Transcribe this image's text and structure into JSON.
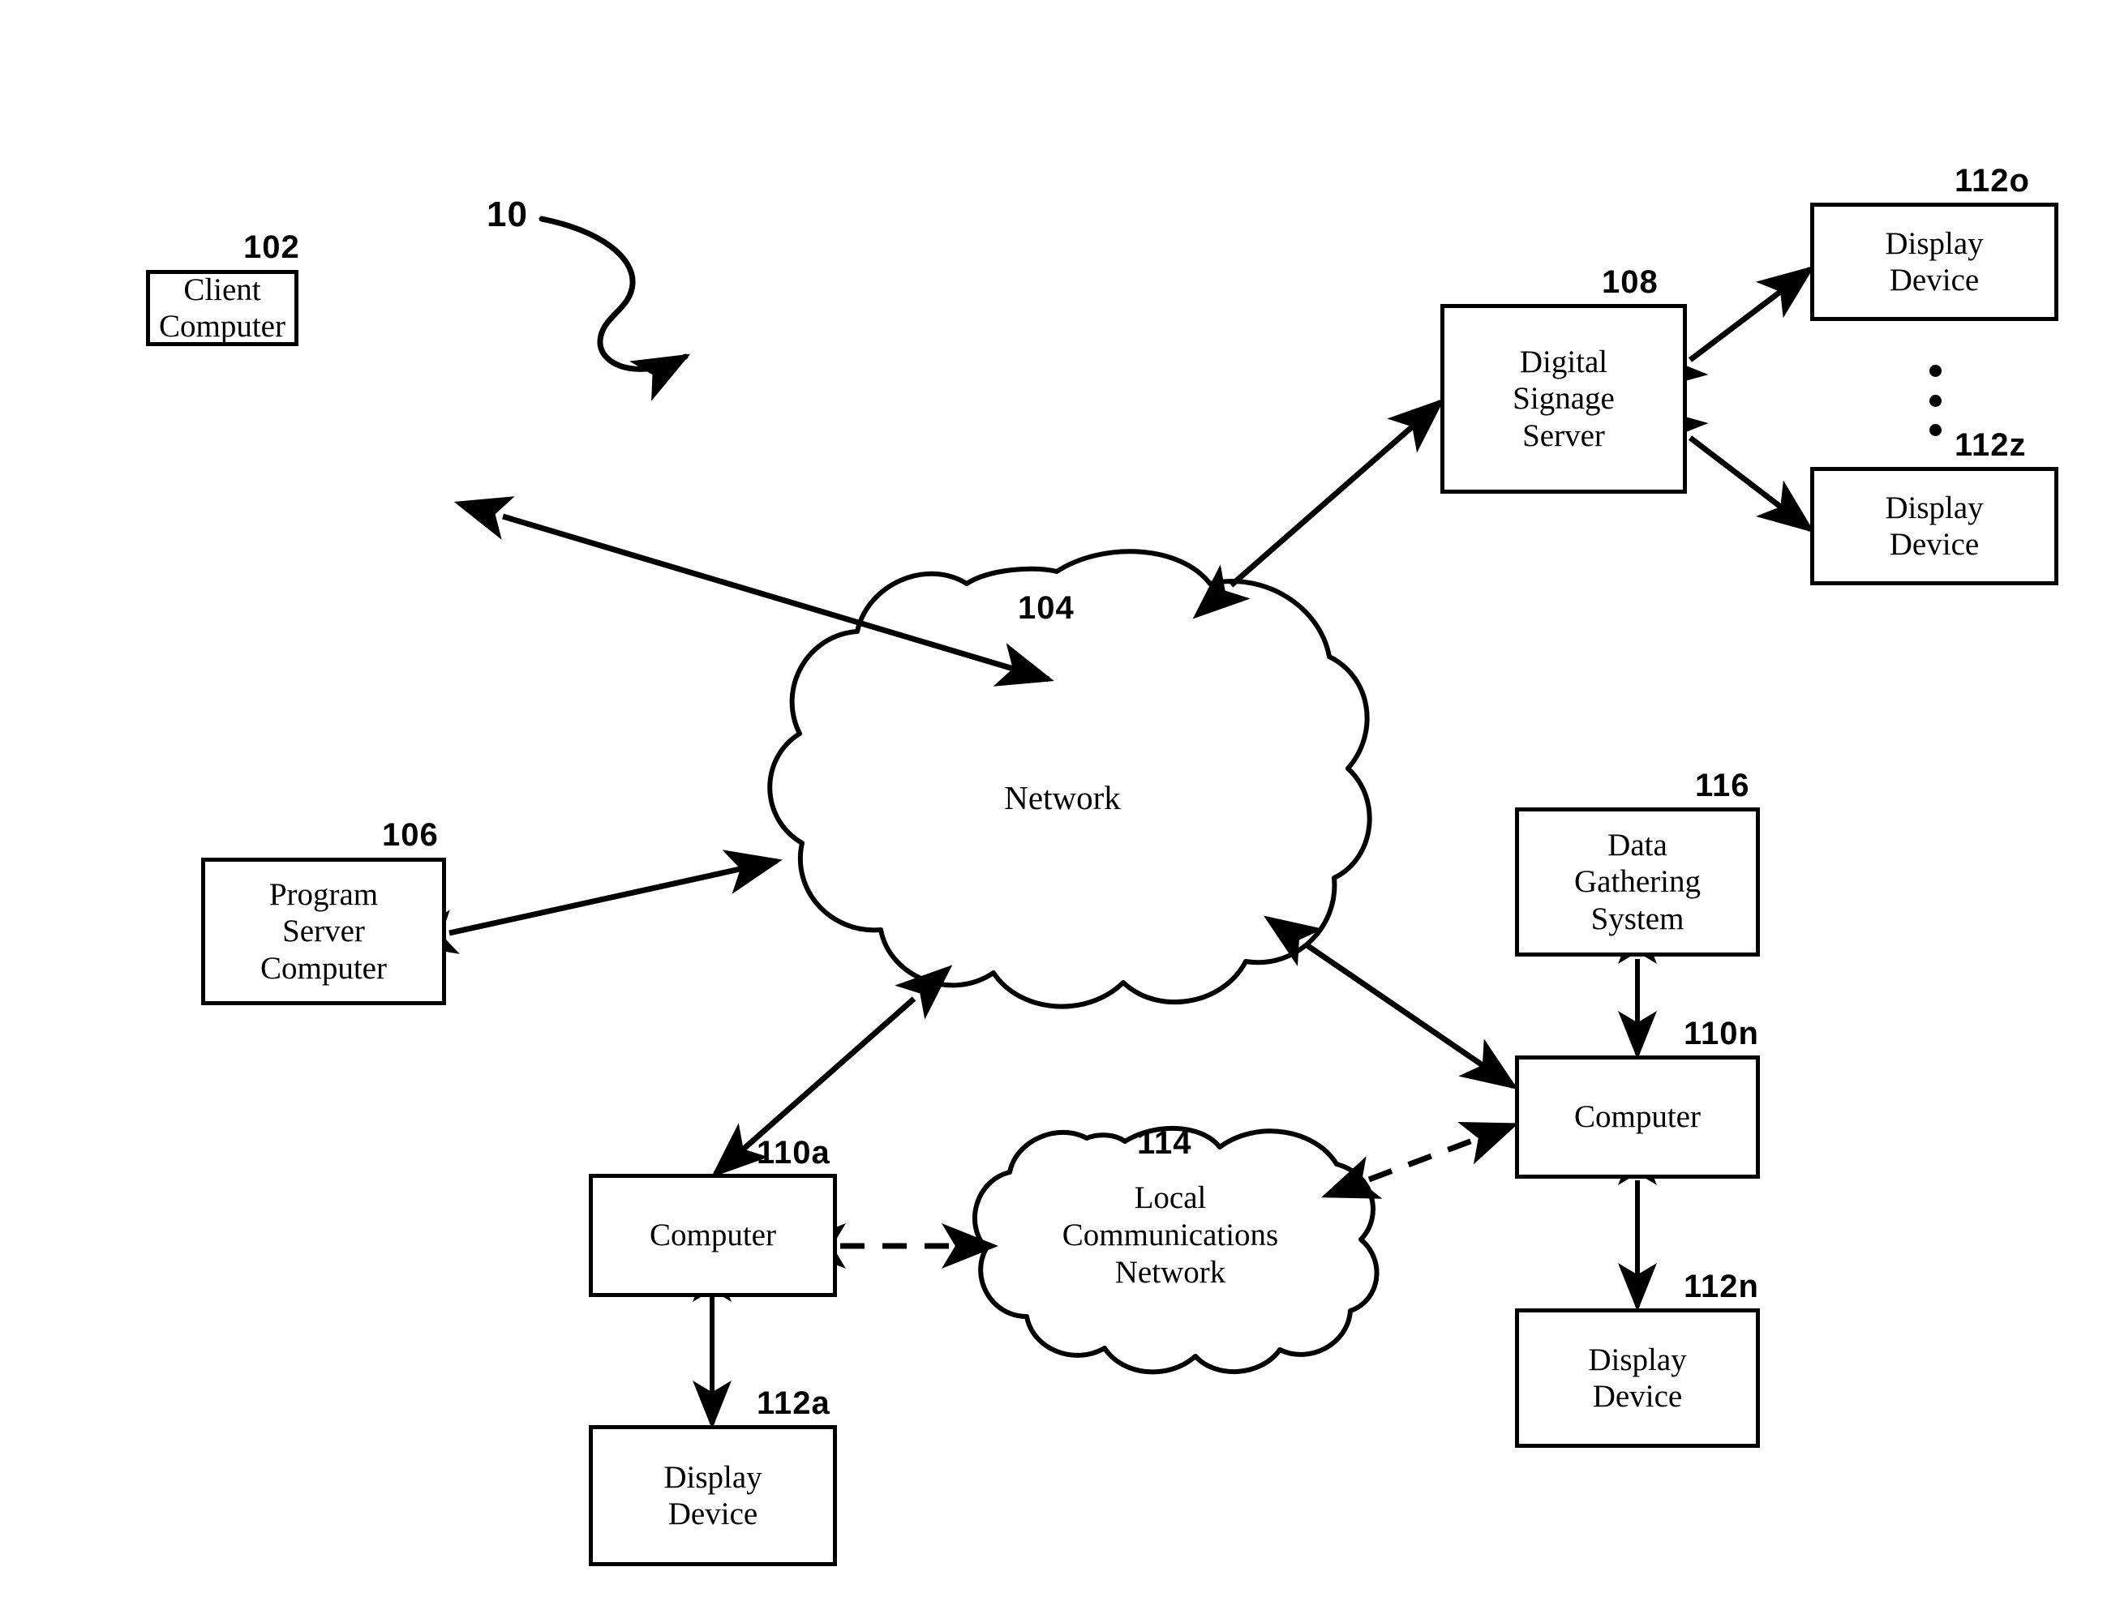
{
  "figure": {
    "figure_ref": "10",
    "title": "Digital signage system network architecture diagram"
  },
  "nodes": [
    {
      "id": "client-computer",
      "ref": "102",
      "label": "Client\nComputer",
      "shape": "rectangle"
    },
    {
      "id": "network",
      "ref": "104",
      "label": "Network",
      "shape": "cloud"
    },
    {
      "id": "program-server-computer",
      "ref": "106",
      "label": "Program\nServer\nComputer",
      "shape": "rectangle"
    },
    {
      "id": "digital-signage-server",
      "ref": "108",
      "label": "Digital\nSignage\nServer",
      "shape": "rectangle"
    },
    {
      "id": "computer-110a",
      "ref": "110a",
      "label": "Computer",
      "shape": "rectangle"
    },
    {
      "id": "computer-110n",
      "ref": "110n",
      "label": "Computer",
      "shape": "rectangle"
    },
    {
      "id": "display-device-112o",
      "ref": "112o",
      "label": "Display\nDevice",
      "shape": "rectangle"
    },
    {
      "id": "display-device-112z",
      "ref": "112z",
      "label": "Display\nDevice",
      "shape": "rectangle"
    },
    {
      "id": "display-device-112a",
      "ref": "112a",
      "label": "Display\nDevice",
      "shape": "rectangle"
    },
    {
      "id": "display-device-112n",
      "ref": "112n",
      "label": "Display\nDevice",
      "shape": "rectangle"
    },
    {
      "id": "local-communications-network",
      "ref": "114",
      "label": "Local\nCommunications\nNetwork",
      "shape": "cloud"
    },
    {
      "id": "data-gathering-system",
      "ref": "116",
      "label": "Data\nGathering\nSystem",
      "shape": "rectangle"
    }
  ],
  "edges": [
    {
      "from": "client-computer",
      "to": "network",
      "style": "solid",
      "arrows": "both"
    },
    {
      "from": "program-server-computer",
      "to": "network",
      "style": "solid",
      "arrows": "both"
    },
    {
      "from": "network",
      "to": "digital-signage-server",
      "style": "solid",
      "arrows": "both"
    },
    {
      "from": "digital-signage-server",
      "to": "display-device-112o",
      "style": "solid",
      "arrows": "both"
    },
    {
      "from": "digital-signage-server",
      "to": "display-device-112z",
      "style": "solid",
      "arrows": "both"
    },
    {
      "from": "network",
      "to": "computer-110a",
      "style": "solid",
      "arrows": "both"
    },
    {
      "from": "network",
      "to": "computer-110n",
      "style": "solid",
      "arrows": "both"
    },
    {
      "from": "computer-110a",
      "to": "local-communications-network",
      "style": "dashed",
      "arrows": "both"
    },
    {
      "from": "local-communications-network",
      "to": "computer-110n",
      "style": "dashed",
      "arrows": "both"
    },
    {
      "from": "computer-110a",
      "to": "display-device-112a",
      "style": "solid",
      "arrows": "both"
    },
    {
      "from": "computer-110n",
      "to": "display-device-112n",
      "style": "solid",
      "arrows": "both"
    },
    {
      "from": "data-gathering-system",
      "to": "computer-110n",
      "style": "solid",
      "arrows": "both"
    }
  ],
  "ellipsis": {
    "between": [
      "display-device-112o",
      "display-device-112z"
    ],
    "glyph": "vertical-dots",
    "count": 3
  },
  "colors": {
    "stroke": "#000000",
    "background": "#ffffff"
  }
}
